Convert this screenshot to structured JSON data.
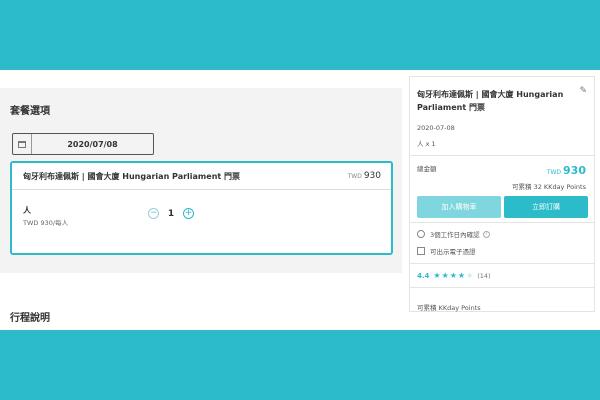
{
  "package_section": {
    "title": "套餐選項",
    "date": "2020/07/08",
    "package": {
      "name": "匈牙利布達佩斯 | 國會大廈 Hungarian Parliament 門票",
      "currency": "TWD",
      "price": "930",
      "person_label": "人",
      "person_price": "TWD 930/每人",
      "qty_minus": "−",
      "quantity": "1",
      "qty_plus": "+"
    }
  },
  "itinerary": {
    "title": "行程說明"
  },
  "summary": {
    "title": "匈牙利布達佩斯 | 國會大廈 Hungarian Parliament 門票",
    "edit_icon": "✎",
    "date": "2020-07-08",
    "quantity": "人 x 1",
    "total_label": "總金額",
    "currency": "TWD",
    "total": "930",
    "earn_points": "可累積 32 KKday Points",
    "add_to_cart": "加入購物車",
    "book_now": "立即訂購",
    "feature_1": "3個工作日內確認",
    "feature_2": "可出示電子憑證",
    "rating": "4.4",
    "stars_full": "★★★★",
    "stars_half": "★",
    "reviews": "(14)",
    "points_note": "可累積 KKday Points"
  },
  "colors": {
    "accent": "#2bbbc9",
    "accent_light": "#7fd6de",
    "backdrop": "#2bbbc9"
  }
}
